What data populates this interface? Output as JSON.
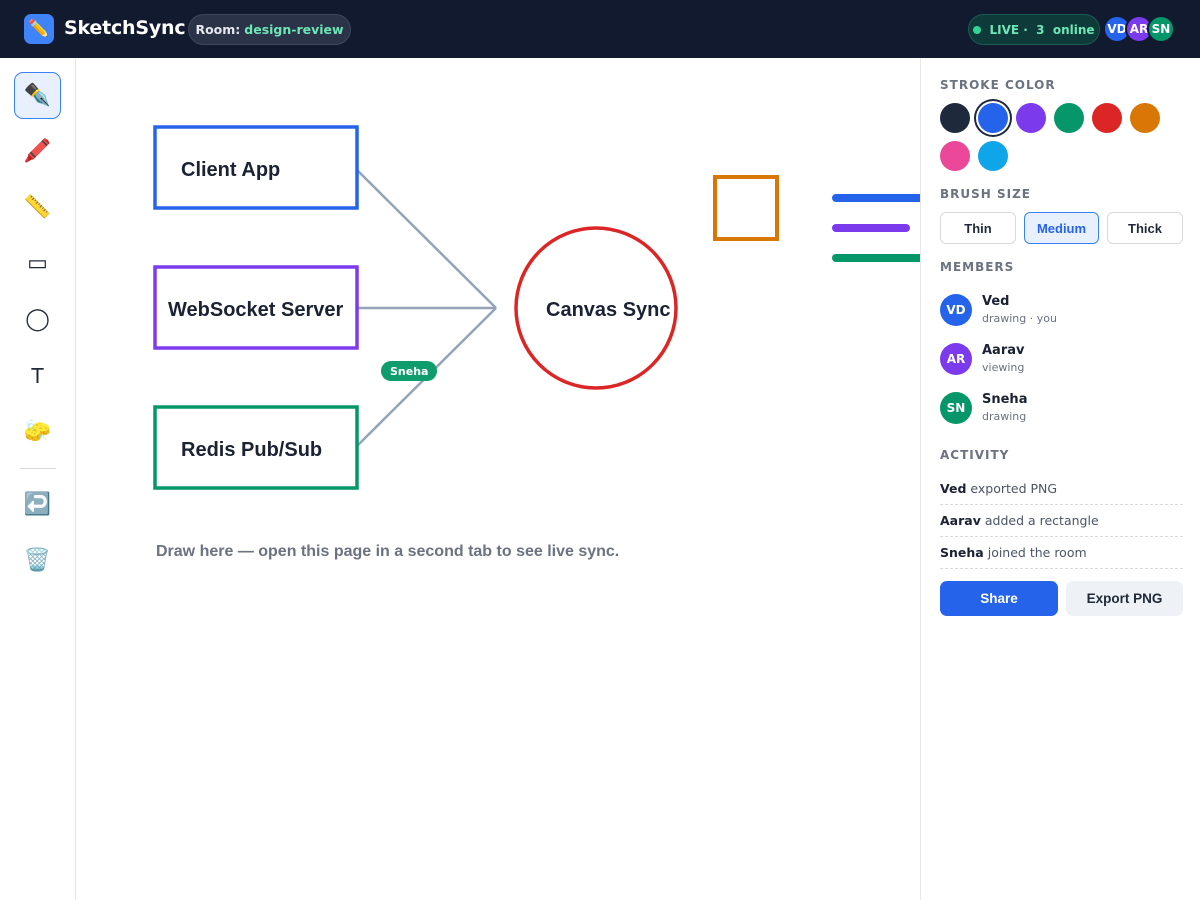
{
  "header": {
    "app_title": "SketchSync",
    "logo_icon": "✏️",
    "room_prefix": "Room:",
    "room_name": "design-review",
    "live_label": "LIVE ·  3  online",
    "avatars": [
      {
        "initials": "VD",
        "color": "#2563eb"
      },
      {
        "initials": "AR",
        "color": "#7c3aed"
      },
      {
        "initials": "SN",
        "color": "#059669"
      }
    ]
  },
  "toolbar": {
    "tools": [
      {
        "name": "pen-tool",
        "icon": "✒️",
        "active": true
      },
      {
        "name": "marker-tool",
        "icon": "🖍️",
        "active": false
      },
      {
        "name": "ruler-tool",
        "icon": "📏",
        "active": false
      },
      {
        "name": "rectangle-tool",
        "icon": "▭",
        "active": false
      },
      {
        "name": "circle-tool",
        "icon": "◯",
        "active": false
      },
      {
        "name": "text-tool",
        "icon": "T",
        "active": false
      },
      {
        "name": "eraser-tool",
        "icon": "🧽",
        "active": false
      },
      {
        "name": "undo-tool",
        "icon": "↩️",
        "active": false
      },
      {
        "name": "clear-tool",
        "icon": "🗑️",
        "active": false
      }
    ]
  },
  "canvas": {
    "boxes": [
      {
        "label": "Client App",
        "color": "#2563eb"
      },
      {
        "label": "WebSocket Server",
        "color": "#7c3aed"
      },
      {
        "label": "Redis Pub/Sub",
        "color": "#059669"
      }
    ],
    "circle_label": "Canvas Sync",
    "circle_color": "#dc2626",
    "square_color": "#d97706",
    "line_color": "#94a3b8",
    "stroke_colors": [
      "#2563eb",
      "#7c3aed",
      "#059669"
    ],
    "hint": "Draw here — open this page in a second tab to see live sync.",
    "cursor_label": "Sneha"
  },
  "panel": {
    "stroke_title": "STROKE COLOR",
    "swatches": [
      "#1e293b",
      "#2563eb",
      "#7c3aed",
      "#059669",
      "#dc2626",
      "#d97706",
      "#ec4899",
      "#0ea5e9"
    ],
    "selected_swatch": 1,
    "brush_title": "BRUSH SIZE",
    "brush_sizes": [
      "Thin",
      "Medium",
      "Thick"
    ],
    "selected_brush": 1,
    "members_title": "MEMBERS",
    "members": [
      {
        "initials": "VD",
        "name": "Ved",
        "status": "drawing · you",
        "color": "#2563eb"
      },
      {
        "initials": "AR",
        "name": "Aarav",
        "status": "viewing",
        "color": "#7c3aed"
      },
      {
        "initials": "SN",
        "name": "Sneha",
        "status": "drawing",
        "color": "#059669"
      }
    ],
    "activity_title": "ACTIVITY",
    "activity": [
      {
        "user": "Ved",
        "text": "exported PNG"
      },
      {
        "user": "Aarav",
        "text": "added a rectangle"
      },
      {
        "user": "Sneha",
        "text": "joined the room"
      }
    ],
    "share_label": "Share",
    "export_label": "Export PNG"
  }
}
